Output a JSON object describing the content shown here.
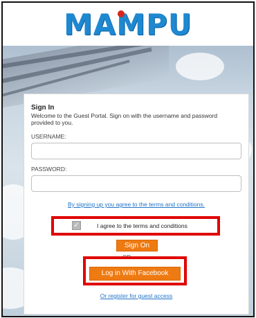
{
  "brand": {
    "logo_text": "MAMPU"
  },
  "signin": {
    "title": "Sign In",
    "description": "Welcome to the Guest Portal. Sign on with the username and password provided to you.",
    "username_label": "USERNAME:",
    "username_value": "",
    "password_label": "PASSWORD:",
    "password_value": "",
    "terms_link": "By signing up you agree to the terms and conditions.",
    "agree_label": "I agree to the terms and conditions",
    "agree_checked": true,
    "sign_on_button": "Sign On",
    "or_text": "OR",
    "facebook_button": "Log in With Facebook",
    "register_link": "Or register for guest access"
  },
  "colors": {
    "brand_blue": "#1e88d0",
    "button_orange": "#ee7a12",
    "highlight_red": "#e00000",
    "link_blue": "#1f73c9"
  },
  "icons": {
    "checkbox": "check-icon"
  }
}
